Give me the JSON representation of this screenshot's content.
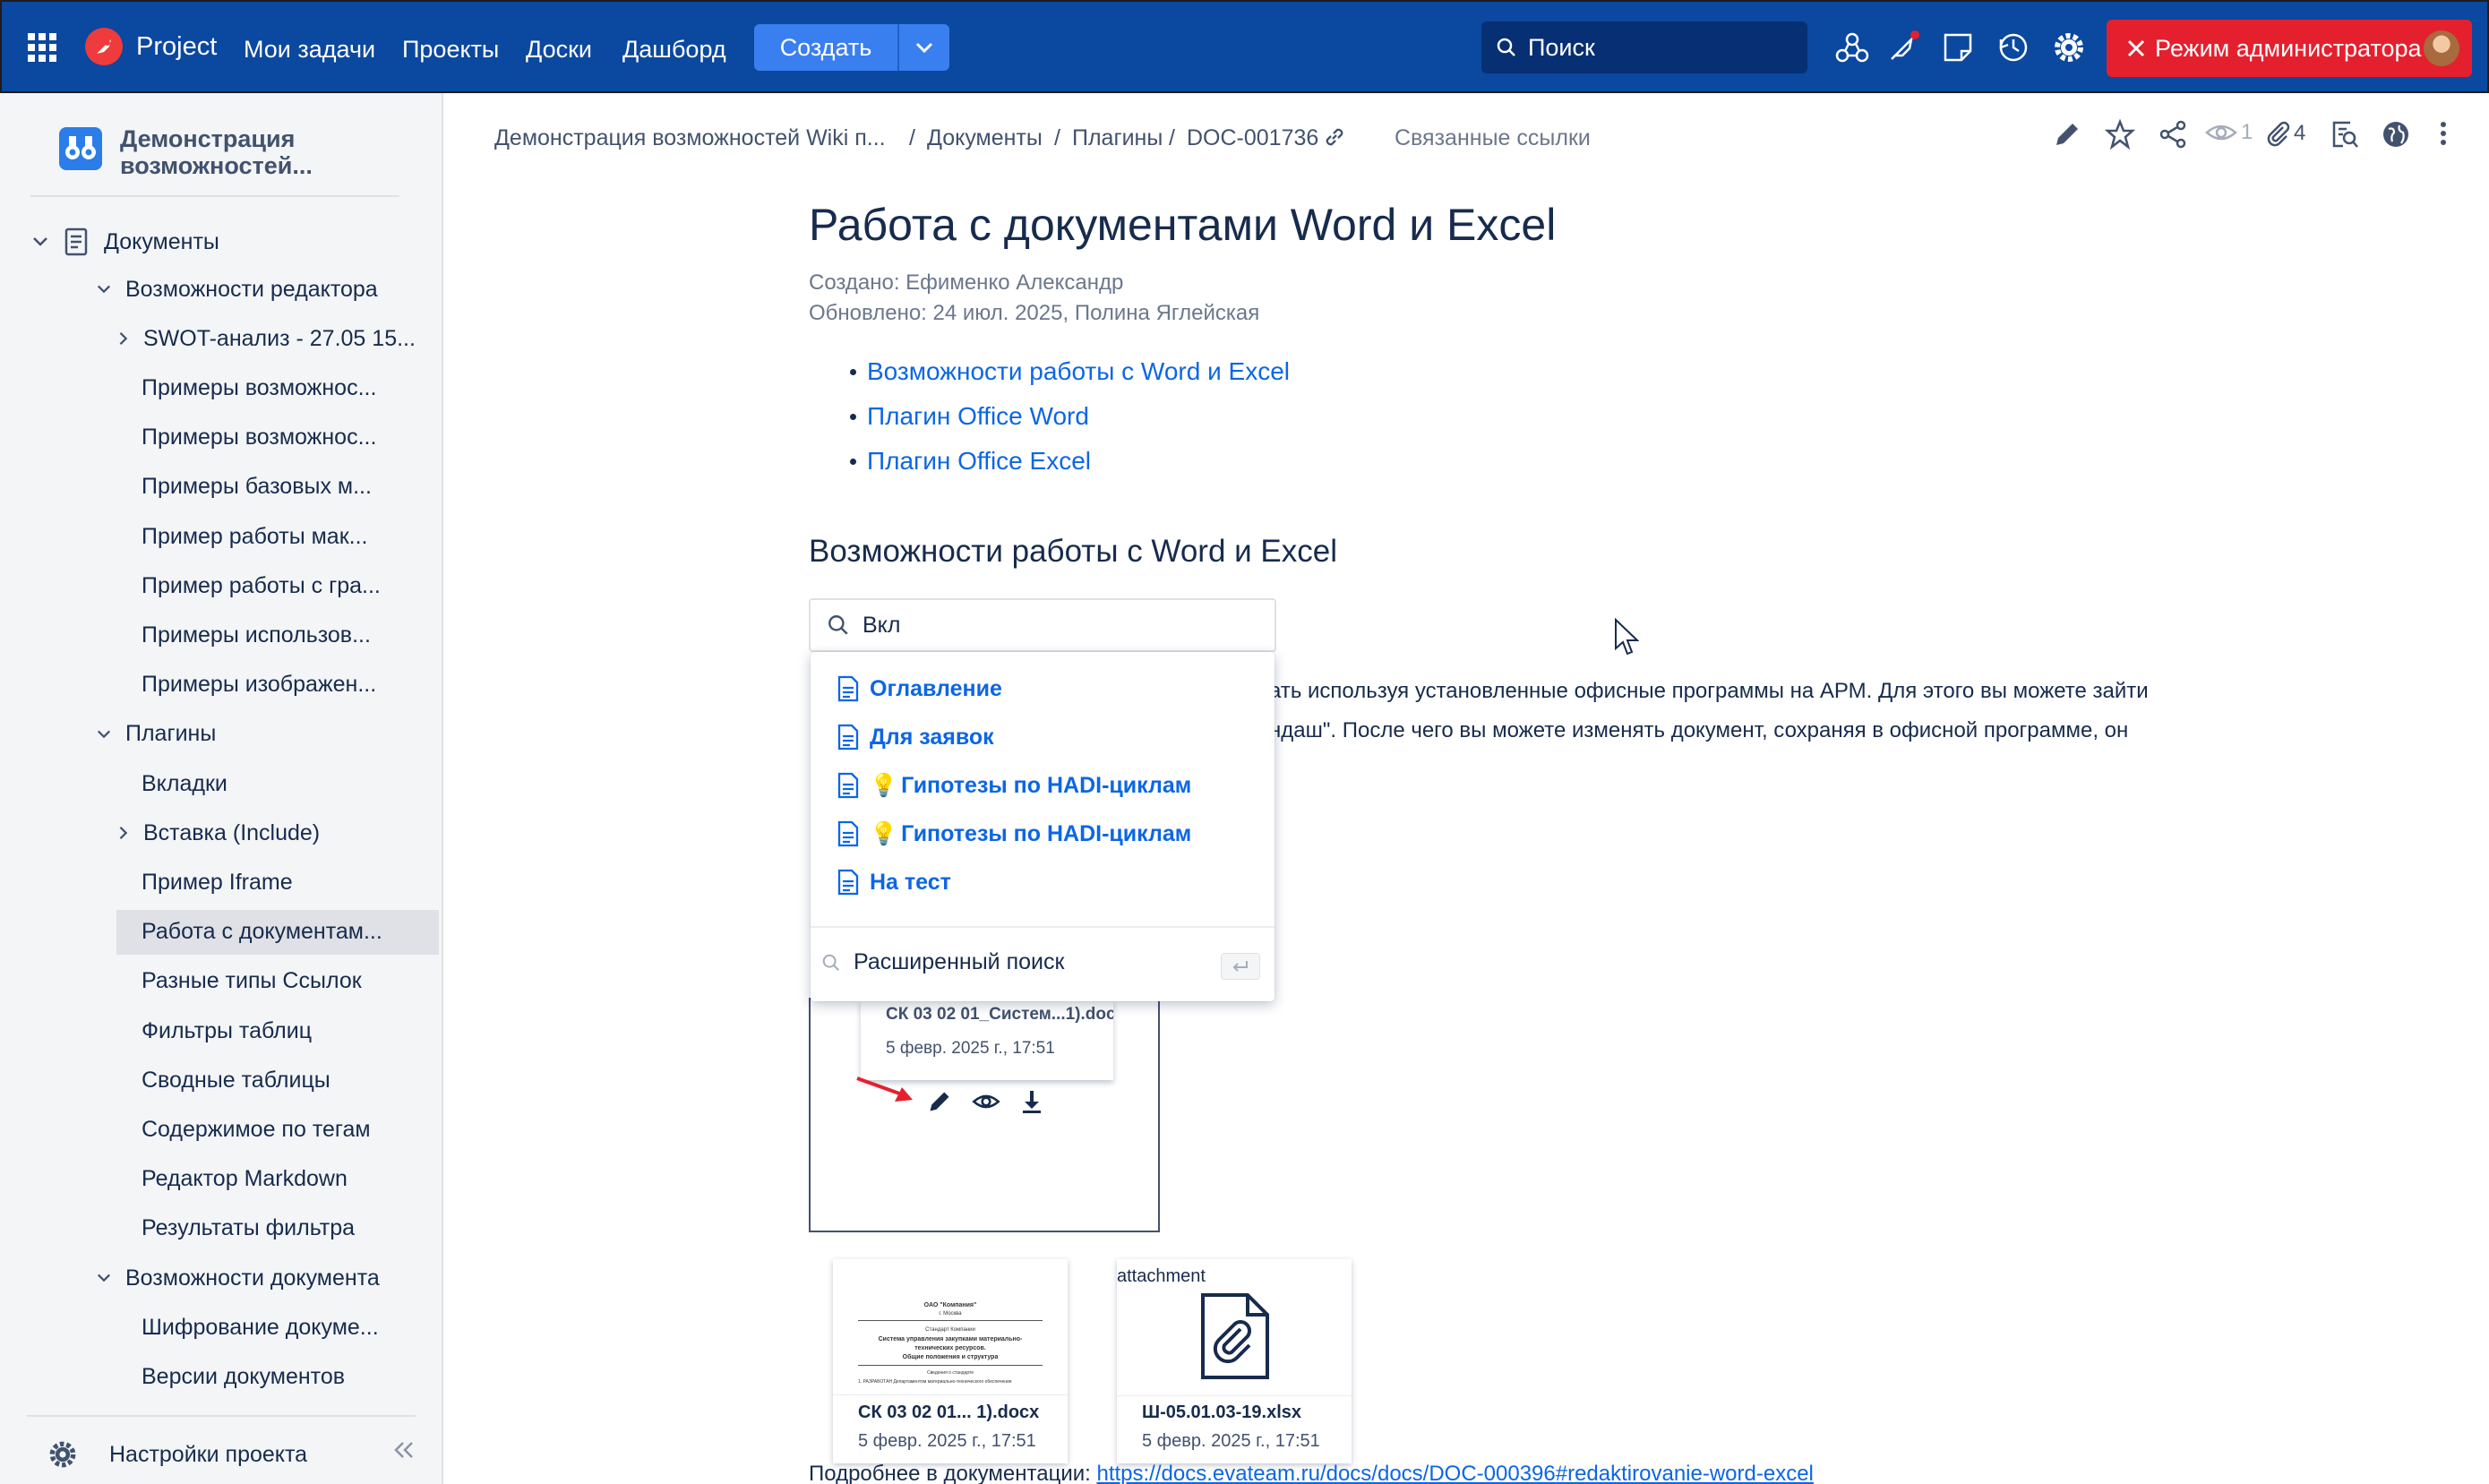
{
  "topbar": {
    "brand": "Project",
    "nav": [
      "Мои задачи",
      "Проекты",
      "Доски",
      "Дашборд"
    ],
    "create_label": "Создать",
    "search_placeholder": "Поиск",
    "admin_label": "Режим администратора",
    "colors": {
      "bar": "#0b48a0",
      "create": "#3a7ff0",
      "admin": "#e5202e"
    }
  },
  "sidebar": {
    "space_title_line1": "Демонстрация",
    "space_title_line2": "возможностей...",
    "root": "Документы",
    "items": [
      "Возможности редактора",
      "SWOT-анализ - 27.05 15...",
      "Примеры возможнос...",
      "Примеры возможнос...",
      "Примеры базовых м...",
      "Пример работы мак...",
      "Пример работы с гра...",
      "Примеры использов...",
      "Примеры изображен...",
      "Плагины",
      "Вкладки",
      "Вставка (Include)",
      "Пример Iframe",
      "Работа с документам...",
      "Разные типы Ссылок",
      "Фильтры таблиц",
      "Сводные таблицы",
      "Содержимое по тегам",
      "Редактор Markdown",
      "Результаты фильтра",
      "Возможности документа",
      "Шифрование докуме...",
      "Версии документов"
    ],
    "settings": "Настройки проекта"
  },
  "breadcrumb": {
    "items": [
      "Демонстрация возможностей Wiki п...",
      "Документы",
      "Плагины",
      "DOC-001736"
    ],
    "separator": "/",
    "related": "Связанные ссылки"
  },
  "toolbar": {
    "watchers": "1",
    "attachments": "4"
  },
  "page": {
    "title": "Работа с документами Word и Excel",
    "created": "Создано: Ефименко Александр",
    "updated": "Обновлено: 24 июл. 2025, Полина Яглейская",
    "toc": [
      "Возможности работы с Word и Excel",
      "Плагин Office Word",
      "Плагин Office Excel"
    ],
    "section_heading": "Возможности работы с Word и Excel",
    "paragraph_line1": "ать используя установленные офисные программы на АРМ. Для этого вы можете зайти",
    "paragraph_line2": "ндаш\". После чего вы можете изменять документ, сохраняя в офисной программе, он",
    "footer_text": "Подробнее в документации:",
    "footer_link": "https://docs.evateam.ru/docs/docs/DOC-000396#redaktirovanie-word-excel"
  },
  "search_popup": {
    "query": "Вкл",
    "results": [
      {
        "label": "Оглавление",
        "emoji": ""
      },
      {
        "label": "Для заявок",
        "emoji": ""
      },
      {
        "label": "Гипотезы по HADI-циклам",
        "emoji": "💡"
      },
      {
        "label": "Гипотезы по HADI-циклам",
        "emoji": "💡"
      },
      {
        "label": "На тест",
        "emoji": ""
      }
    ],
    "advanced": "Расширенный поиск"
  },
  "screenshot_card": {
    "name": "СК 03 02 01_Систем...1).docx",
    "date": "5 февр. 2025 г., 17:51"
  },
  "attachments": [
    {
      "name": "СК 03 02 01... 1).docx",
      "date": "5 февр. 2025 г., 17:51",
      "preview": {
        "company": "ОАО \"Компания\"",
        "city": "г. Москва",
        "standard": "Стандарт Компании",
        "line1": "Система управления закупками материально-",
        "line2": "технических ресурсов.",
        "line3": "Общие положения и структура",
        "intro": "Сведения о стандарте",
        "item": "1. РАЗРАБОТАН Департаментом материально-технического обеспечения"
      }
    },
    {
      "label": "attachment",
      "name": "Ш-05.01.03-19.xlsx",
      "date": "5 февр. 2025 г., 17:51"
    }
  ]
}
